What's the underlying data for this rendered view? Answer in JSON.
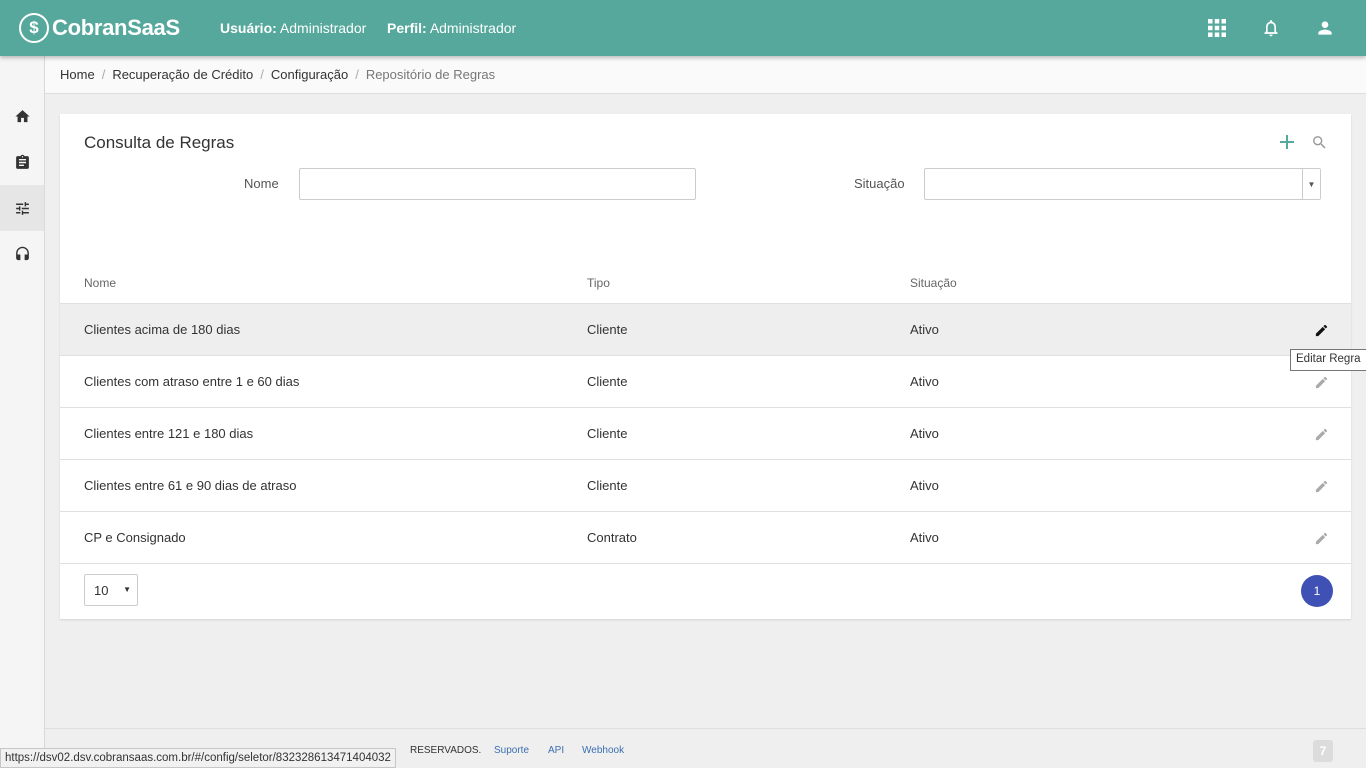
{
  "app": {
    "logo_symbol": "$",
    "logo_text": "CobranSaaS",
    "brand_color": "#55a89b"
  },
  "header": {
    "user_label": "Usuário:",
    "user_value": "Administrador",
    "profile_label": "Perfil:",
    "profile_value": "Administrador",
    "icons": [
      "apps-grid-icon",
      "notifications-bell-icon",
      "account-icon"
    ]
  },
  "sidebar": {
    "items": [
      {
        "name": "home",
        "icon": "home-icon"
      },
      {
        "name": "clipboard",
        "icon": "clipboard-icon"
      },
      {
        "name": "settings",
        "icon": "tune-sliders-icon",
        "active": true
      },
      {
        "name": "support",
        "icon": "headset-icon"
      }
    ]
  },
  "breadcrumb": {
    "items": [
      "Home",
      "Recuperação de Crédito",
      "Configuração",
      "Repositório de Regras"
    ]
  },
  "card": {
    "title": "Consulta de Regras",
    "actions": [
      "add-icon",
      "search-icon"
    ],
    "filters": {
      "name_label": "Nome",
      "name_value": "",
      "name_placeholder": "",
      "status_label": "Situação",
      "status_value": ""
    },
    "table": {
      "columns": [
        "Nome",
        "Tipo",
        "Situação"
      ],
      "rows": [
        {
          "name": "Clientes acima de 180 dias",
          "type": "Cliente",
          "status": "Ativo"
        },
        {
          "name": "Clientes com atraso entre 1 e 60 dias",
          "type": "Cliente",
          "status": "Ativo"
        },
        {
          "name": "Clientes entre 121 e 180 dias",
          "type": "Cliente",
          "status": "Ativo"
        },
        {
          "name": "Clientes entre 61 e 90 dias de atraso",
          "type": "Cliente",
          "status": "Ativo"
        },
        {
          "name": "CP e Consignado",
          "type": "Contrato",
          "status": "Ativo"
        }
      ],
      "hovered_row_index": 0
    },
    "pagination": {
      "page_size": "10",
      "current_page": "1",
      "accent": "#3f51b5"
    }
  },
  "tooltip": {
    "text": "Editar Regra"
  },
  "footer": {
    "partial_text": "RESERVADOS.",
    "links": [
      "Suporte",
      "API",
      "Webhook"
    ]
  },
  "statusbar": {
    "url": "https://dsv02.dsv.cobransaas.com.br/#/config/seletor/832328613471404032"
  }
}
